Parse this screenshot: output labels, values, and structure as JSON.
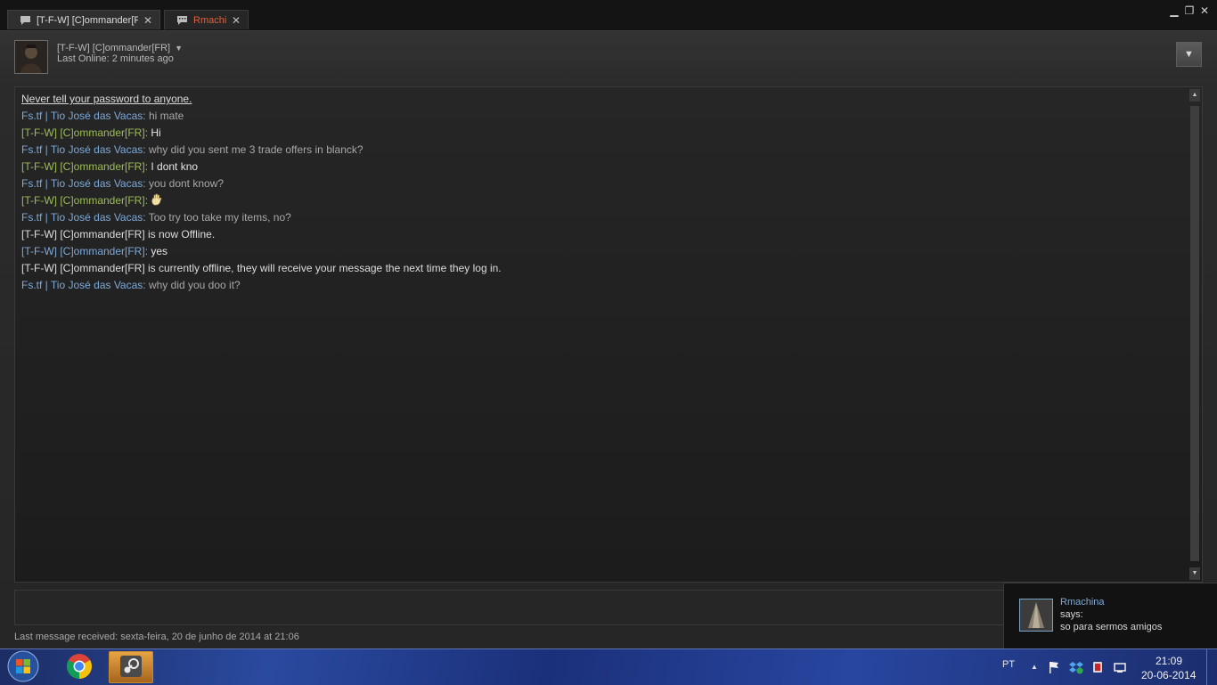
{
  "window": {
    "tabs": [
      {
        "label": "[T-F-W] [C]ommander[FR]",
        "close": "✕"
      },
      {
        "label": "Rmachina",
        "close": "✕"
      }
    ],
    "controls": {
      "minimize": "▁",
      "maximize": "❐",
      "close": "✕"
    }
  },
  "friend": {
    "name": "[T-F-W] [C]ommander[FR]",
    "caret": "▼",
    "status": "Last Online: 2 minutes ago"
  },
  "options_caret": "▼",
  "chat": {
    "warning": "Never tell your password to anyone.",
    "messages": [
      {
        "sender": "Fs.tf | Tio José das Vacas",
        "text": "hi mate"
      },
      {
        "sender": "[T-F-W] [C]ommander[FR]",
        "text": "Hi"
      },
      {
        "sender": "Fs.tf | Tio José das Vacas",
        "text": "why did you sent me 3 trade offers in blanck?"
      },
      {
        "sender": "[T-F-W] [C]ommander[FR]",
        "text": "I dont kno"
      },
      {
        "sender": "Fs.tf | Tio José das Vacas",
        "text": "you dont know?"
      },
      {
        "sender": "[T-F-W] [C]ommander[FR]",
        "text": ""
      },
      {
        "sender": "Fs.tf | Tio José das Vacas",
        "text": "Too try too take my items, no?"
      },
      {
        "system": "[T-F-W] [C]ommander[FR] is now Offline."
      },
      {
        "sender": "[T-F-W] [C]ommander[FR]",
        "text": "yes"
      },
      {
        "system": "[T-F-W] [C]ommander[FR] is currently offline, they will receive your message the next time they log in."
      },
      {
        "sender": "Fs.tf | Tio José das Vacas",
        "text": "why did you doo it?"
      }
    ],
    "sep": ": ",
    "emoji": "hand-emoticon"
  },
  "status_bar": {
    "last_message": "Last message received: sexta-feira, 20 de junho de 2014 at 21:06"
  },
  "notification": {
    "name": "Rmachina",
    "says": "says:",
    "text": "so para sermos amigos"
  },
  "taskbar": {
    "lang": "PT",
    "tray_chevron": "▲",
    "time": "21:09",
    "date": "20-06-2014"
  },
  "colors": {
    "self_name": "#7fa9d6",
    "friend_name": "#9cbb5a",
    "active_tab_text": "#e0603c"
  }
}
